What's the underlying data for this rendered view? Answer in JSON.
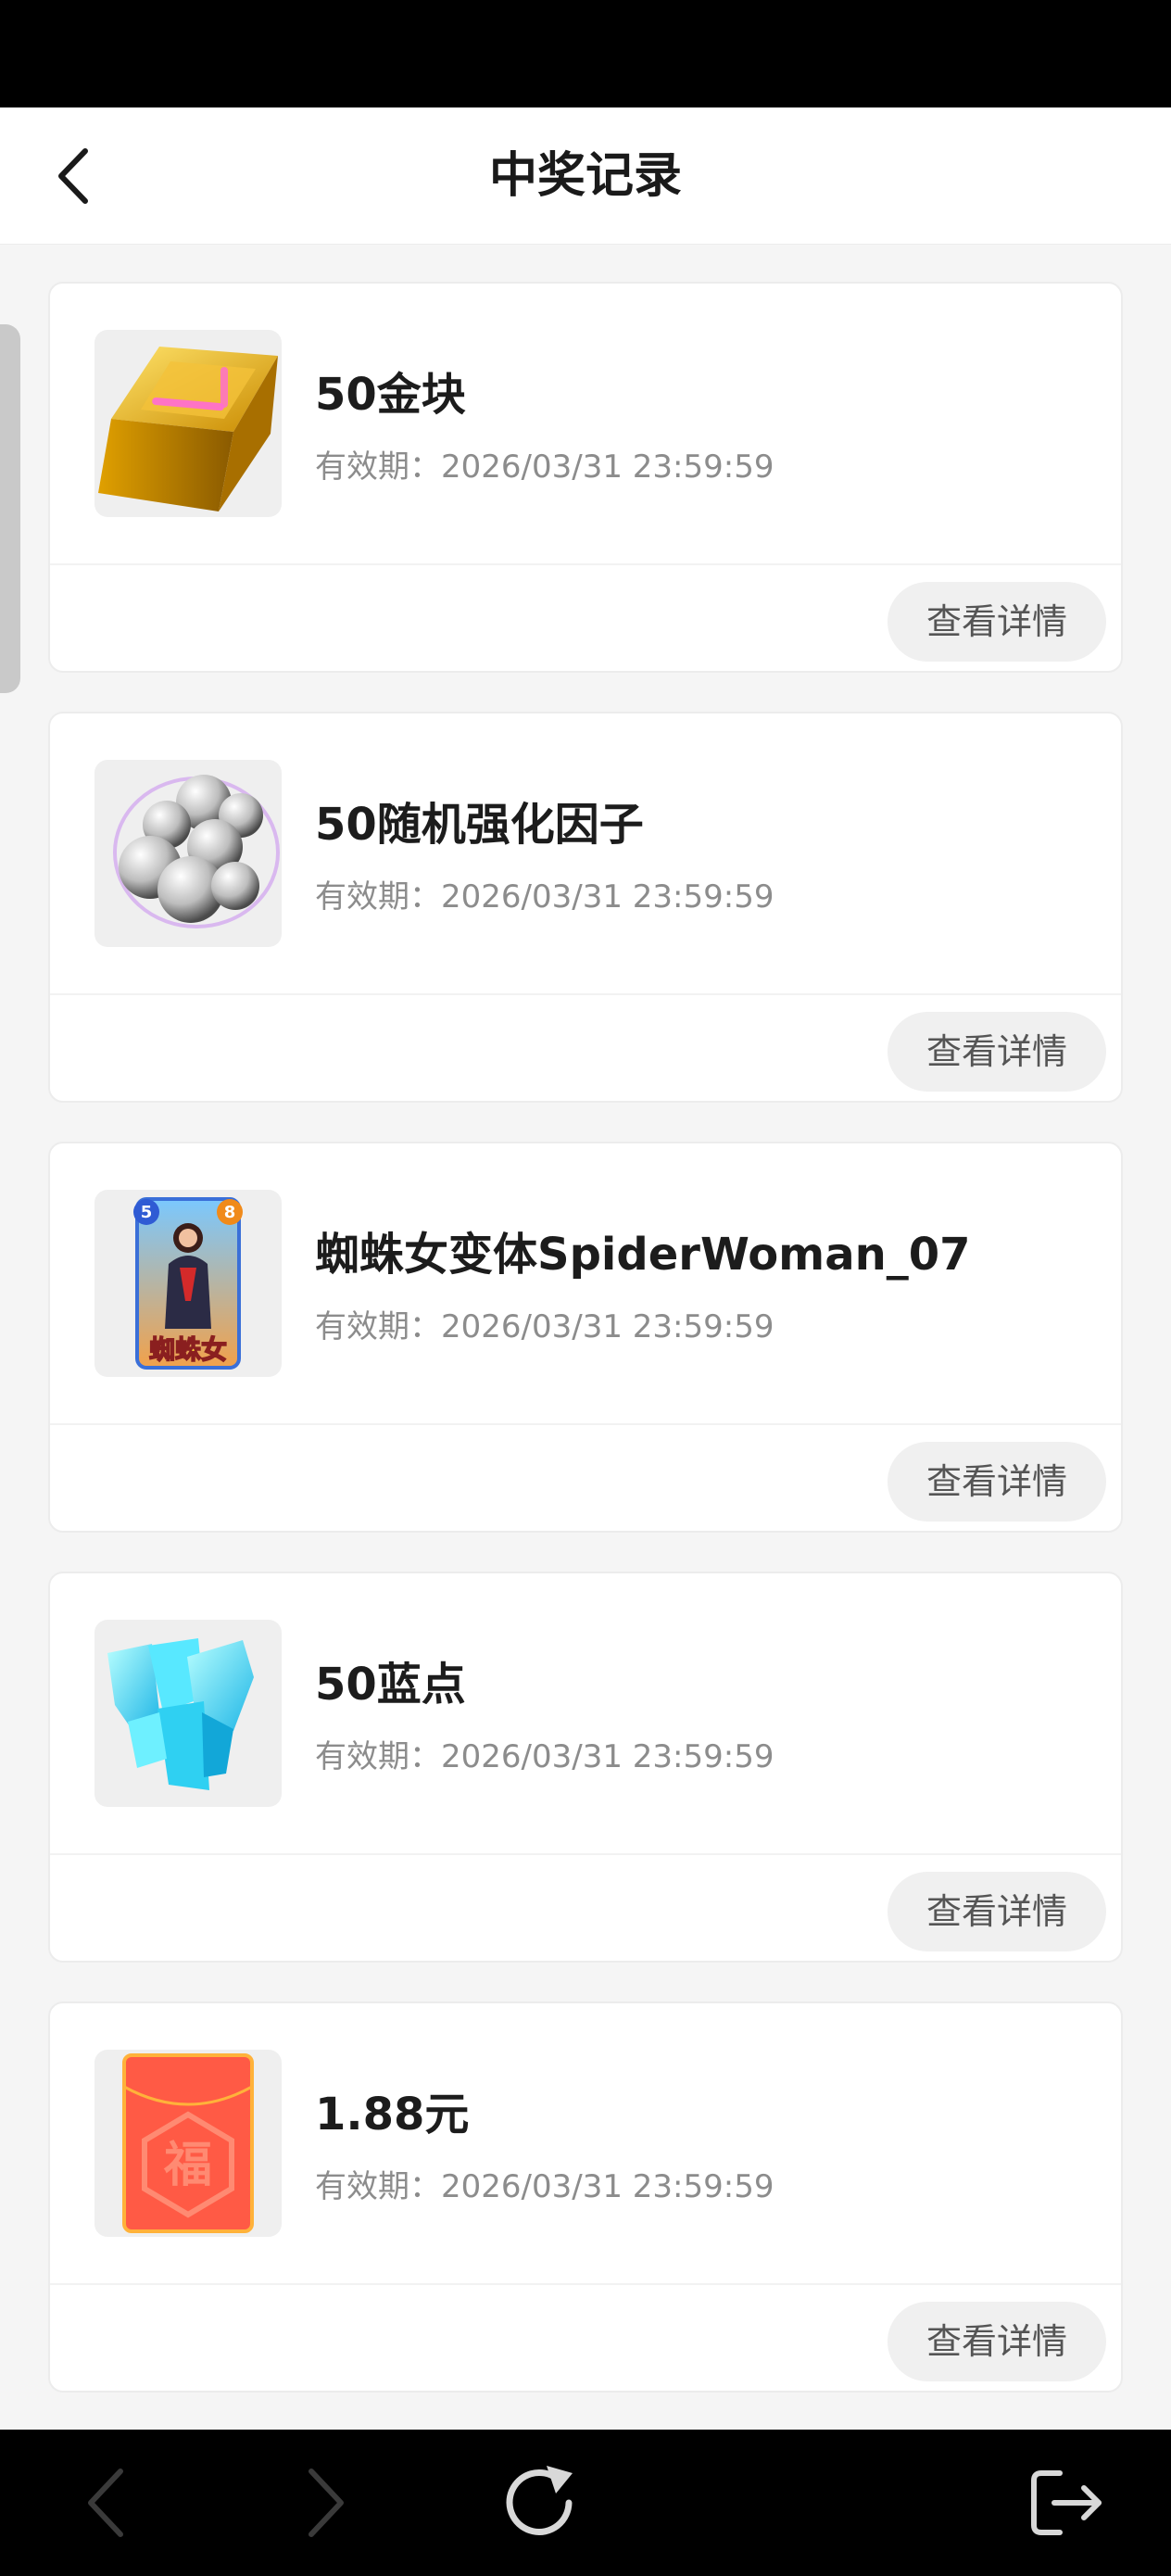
{
  "header": {
    "title": "中奖记录"
  },
  "items": [
    {
      "name": "50金块",
      "expiry": "有效期：2026/03/31 23:59:59",
      "button": "查看详情"
    },
    {
      "name": "50随机强化因子",
      "expiry": "有效期：2026/03/31 23:59:59",
      "button": "查看详情"
    },
    {
      "name": "蜘蛛女变体SpiderWoman_07",
      "expiry": "有效期：2026/03/31 23:59:59",
      "button": "查看详情",
      "card_text": {
        "left_badge": "5",
        "right_badge": "8",
        "caption": "蜘蛛女"
      }
    },
    {
      "name": "50蓝点",
      "expiry": "有效期：2026/03/31 23:59:59",
      "button": "查看详情"
    },
    {
      "name": "1.88元",
      "expiry": "有效期：2026/03/31 23:59:59",
      "button": "查看详情",
      "envelope_text": "福"
    }
  ],
  "nav": {
    "icons": [
      "chevron-left-icon",
      "chevron-right-icon",
      "refresh-icon",
      "exit-icon"
    ]
  },
  "colors": {
    "status_bar": "#000000",
    "nav_bar": "#000000",
    "background": "#f5f5f5",
    "card": "#ffffff"
  }
}
